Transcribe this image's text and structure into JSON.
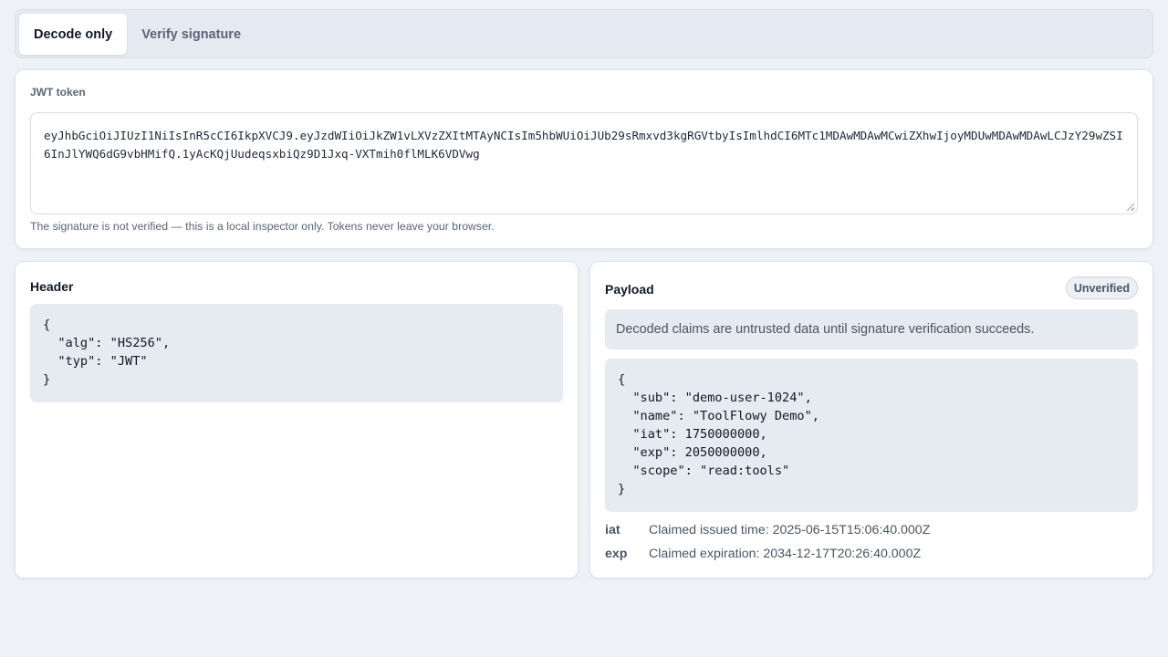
{
  "tabs": [
    {
      "label": "Decode only",
      "active": true
    },
    {
      "label": "Verify signature",
      "active": false
    }
  ],
  "token": {
    "label": "JWT token",
    "value": "eyJhbGciOiJIUzI1NiIsInR5cCI6IkpXVCJ9.eyJzdWIiOiJkZW1vLXVzZXItMTAyNCIsIm5hbWUiOiJUb29sRmxvd3kgRGVtbyIsImlhdCI6MTc1MDAwMDAwMCwiZXhwIjoyMDUwMDAwMDAwLCJzY29wZSI6InJlYWQ6dG9vbHMifQ.1yAcKQjUudeqsxbiQz9D1Jxq-VXTmih0flMLK6VDVwg",
    "note": "The signature is not verified — this is a local inspector only. Tokens never leave your browser."
  },
  "header_panel": {
    "title": "Header",
    "json": "{\n  \"alg\": \"HS256\",\n  \"typ\": \"JWT\"\n}"
  },
  "payload_panel": {
    "title": "Payload",
    "badge": "Unverified",
    "notice": "Decoded claims are untrusted data until signature verification succeeds.",
    "json": "{\n  \"sub\": \"demo-user-1024\",\n  \"name\": \"ToolFlowy Demo\",\n  \"iat\": 1750000000,\n  \"exp\": 2050000000,\n  \"scope\": \"read:tools\"\n}",
    "claims": [
      {
        "key": "iat",
        "text": "Claimed issued time: 2025-06-15T15:06:40.000Z"
      },
      {
        "key": "exp",
        "text": "Claimed expiration: 2034-12-17T20:26:40.000Z"
      }
    ]
  }
}
